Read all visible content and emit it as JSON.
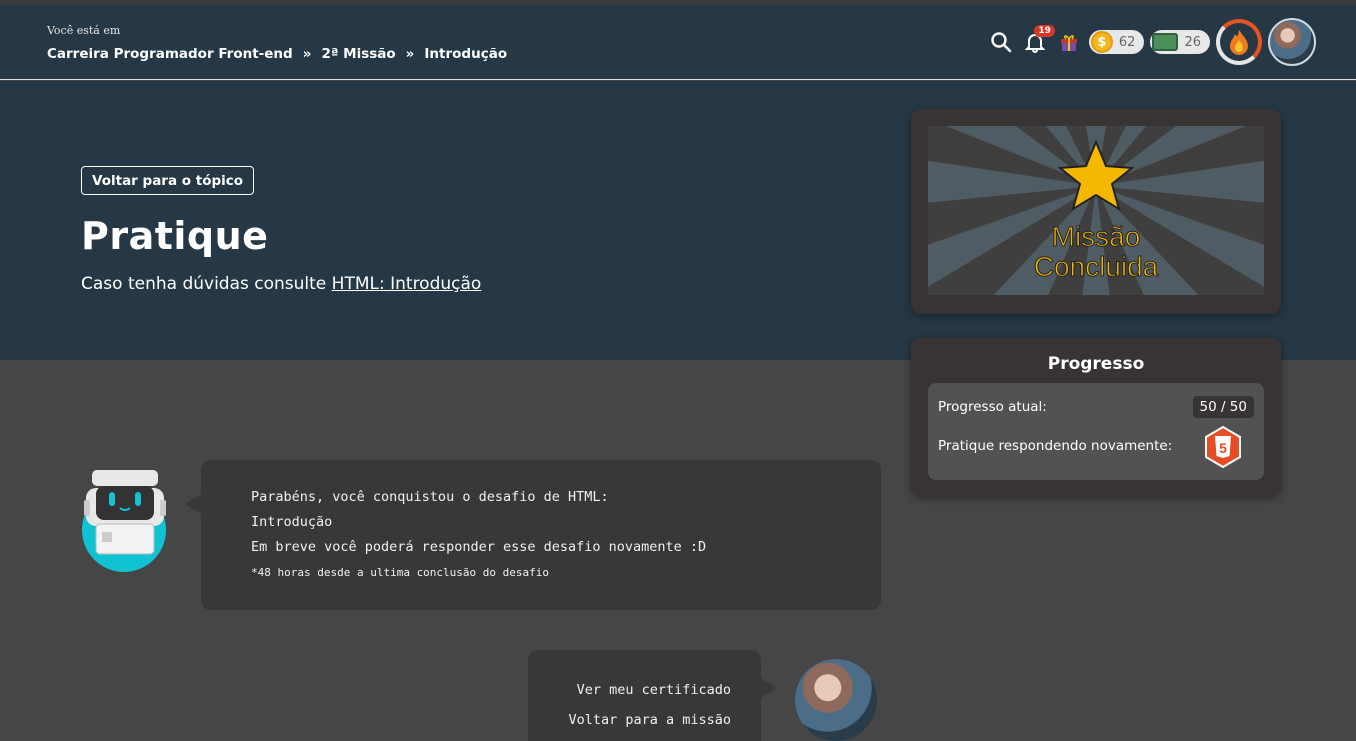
{
  "header": {
    "here_label": "Você está em",
    "breadcrumbs": [
      "Carreira Programador Front-end",
      "2ª Missão",
      "Introdução"
    ],
    "separator": "»",
    "notifications_count": "19",
    "coins": "62",
    "tickets": "26",
    "icons": [
      "search-icon",
      "bell-icon",
      "gift-icon",
      "coin-icon",
      "ticket-icon",
      "fire-icon"
    ]
  },
  "hero": {
    "back_button": "Voltar para o tópico",
    "title": "Pratique",
    "subtitle_prefix": "Caso tenha dúvidas consulte ",
    "subtitle_link": "HTML: Introdução"
  },
  "mission": {
    "line1": "Missão",
    "line2": "Concluida"
  },
  "progress": {
    "title": "Progresso",
    "current_label": "Progresso atual:",
    "current_value": "50 / 50",
    "practice_label": "Pratique respondendo novamente:",
    "badge_text": "5"
  },
  "chat": {
    "bot_line1": "Parabéns, você conquistou o desafio de HTML:",
    "bot_line2": "Introdução",
    "bot_line3": "Em breve você poderá responder esse desafio novamente :D",
    "bot_note": "*48 horas desde a ultima conclusão do desafio",
    "user_option1": "Ver meu certificado",
    "user_option2": "Voltar para a missão"
  },
  "colors": {
    "header_bg": "#263845",
    "body_bg": "#464646",
    "card_bg": "#383433",
    "accent_gold": "#f5b800",
    "html5_orange": "#e44d26"
  }
}
